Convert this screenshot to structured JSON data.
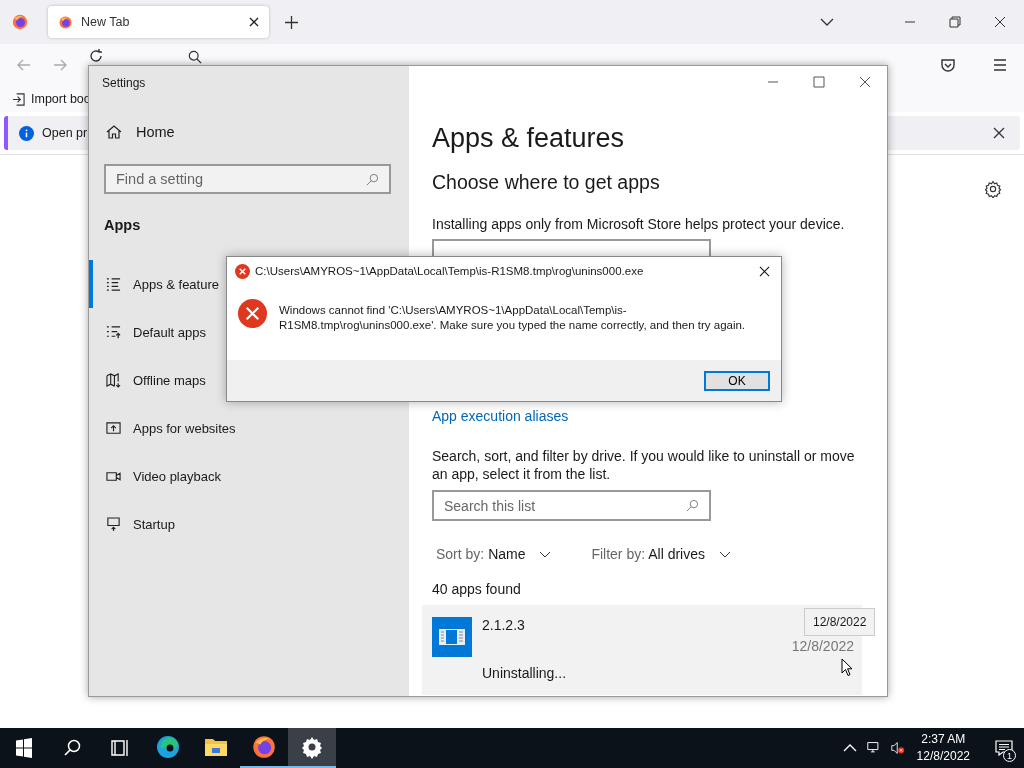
{
  "browser": {
    "tabs": [
      {
        "title": "New Tab",
        "selected": true
      }
    ],
    "bookmarks": [
      {
        "label": "Import boo"
      }
    ],
    "notification": {
      "text": "Open pr"
    }
  },
  "settings": {
    "title": "Settings",
    "home": "Home",
    "search": {
      "placeholder": "Find a setting"
    },
    "section": "Apps",
    "nav": [
      {
        "label": "Apps & feature",
        "selected": true
      },
      {
        "label": "Default apps",
        "selected": false
      },
      {
        "label": "Offline maps",
        "selected": false
      },
      {
        "label": "Apps for websites",
        "selected": false
      },
      {
        "label": "Video playback",
        "selected": false
      },
      {
        "label": "Startup",
        "selected": false
      }
    ],
    "heading": "Apps & features",
    "subheading": "Choose where to get apps",
    "intro": "Installing apps only from Microsoft Store helps protect your device.",
    "link": "App execution aliases",
    "description": "Search, sort, and filter by drive. If you would like to uninstall or move an app, select it from the list.",
    "list_search": {
      "placeholder": "Search this list"
    },
    "sort": {
      "label": "Sort by:",
      "value": "Name"
    },
    "filter": {
      "label": "Filter by:",
      "value": "All drives"
    },
    "count": "40 apps found",
    "apps": [
      {
        "name": "2.1.2.3",
        "date": "12/8/2022",
        "status": "Uninstalling..."
      }
    ],
    "tooltip": "12/8/2022"
  },
  "dialog": {
    "title": "C:\\Users\\AMYROS~1\\AppData\\Local\\Temp\\is-R1SM8.tmp\\rog\\unins000.exe",
    "message": "Windows cannot find 'C:\\Users\\AMYROS~1\\AppData\\Local\\Temp\\is-R1SM8.tmp\\rog\\unins000.exe'. Make sure you typed the name correctly, and then try again.",
    "button": "OK"
  },
  "taskbar": {
    "apps": [
      {
        "kind": "edge",
        "running": false,
        "active": false
      },
      {
        "kind": "explorer",
        "running": false,
        "active": false
      },
      {
        "kind": "firefox",
        "running": true,
        "active": false
      },
      {
        "kind": "settings",
        "running": true,
        "active": true
      }
    ],
    "time": "2:37 AM",
    "date": "12/8/2022",
    "notifications": "1"
  }
}
